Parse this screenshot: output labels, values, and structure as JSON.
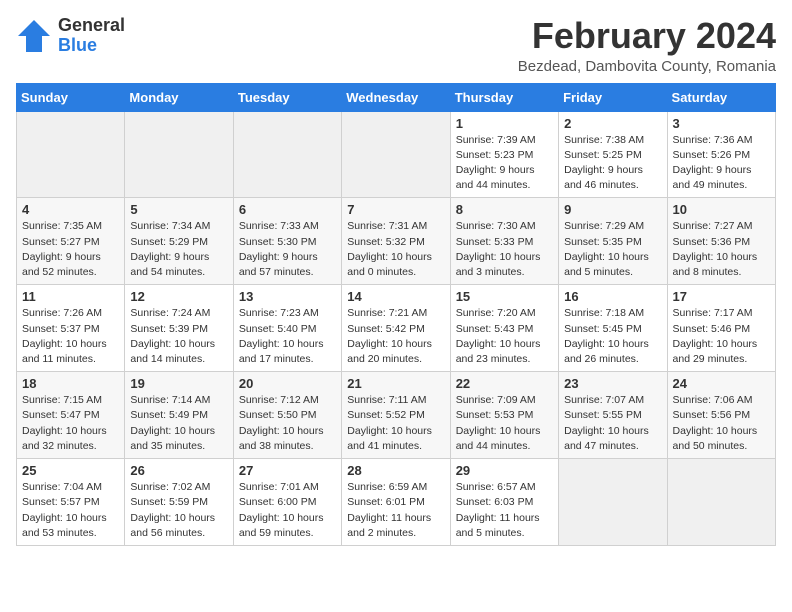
{
  "header": {
    "logo_general": "General",
    "logo_blue": "Blue",
    "month_title": "February 2024",
    "subtitle": "Bezdead, Dambovita County, Romania"
  },
  "weekdays": [
    "Sunday",
    "Monday",
    "Tuesday",
    "Wednesday",
    "Thursday",
    "Friday",
    "Saturday"
  ],
  "weeks": [
    [
      {
        "day": "",
        "sunrise": "",
        "sunset": "",
        "daylight": ""
      },
      {
        "day": "",
        "sunrise": "",
        "sunset": "",
        "daylight": ""
      },
      {
        "day": "",
        "sunrise": "",
        "sunset": "",
        "daylight": ""
      },
      {
        "day": "",
        "sunrise": "",
        "sunset": "",
        "daylight": ""
      },
      {
        "day": "1",
        "sunrise": "Sunrise: 7:39 AM",
        "sunset": "Sunset: 5:23 PM",
        "daylight": "Daylight: 9 hours and 44 minutes."
      },
      {
        "day": "2",
        "sunrise": "Sunrise: 7:38 AM",
        "sunset": "Sunset: 5:25 PM",
        "daylight": "Daylight: 9 hours and 46 minutes."
      },
      {
        "day": "3",
        "sunrise": "Sunrise: 7:36 AM",
        "sunset": "Sunset: 5:26 PM",
        "daylight": "Daylight: 9 hours and 49 minutes."
      }
    ],
    [
      {
        "day": "4",
        "sunrise": "Sunrise: 7:35 AM",
        "sunset": "Sunset: 5:27 PM",
        "daylight": "Daylight: 9 hours and 52 minutes."
      },
      {
        "day": "5",
        "sunrise": "Sunrise: 7:34 AM",
        "sunset": "Sunset: 5:29 PM",
        "daylight": "Daylight: 9 hours and 54 minutes."
      },
      {
        "day": "6",
        "sunrise": "Sunrise: 7:33 AM",
        "sunset": "Sunset: 5:30 PM",
        "daylight": "Daylight: 9 hours and 57 minutes."
      },
      {
        "day": "7",
        "sunrise": "Sunrise: 7:31 AM",
        "sunset": "Sunset: 5:32 PM",
        "daylight": "Daylight: 10 hours and 0 minutes."
      },
      {
        "day": "8",
        "sunrise": "Sunrise: 7:30 AM",
        "sunset": "Sunset: 5:33 PM",
        "daylight": "Daylight: 10 hours and 3 minutes."
      },
      {
        "day": "9",
        "sunrise": "Sunrise: 7:29 AM",
        "sunset": "Sunset: 5:35 PM",
        "daylight": "Daylight: 10 hours and 5 minutes."
      },
      {
        "day": "10",
        "sunrise": "Sunrise: 7:27 AM",
        "sunset": "Sunset: 5:36 PM",
        "daylight": "Daylight: 10 hours and 8 minutes."
      }
    ],
    [
      {
        "day": "11",
        "sunrise": "Sunrise: 7:26 AM",
        "sunset": "Sunset: 5:37 PM",
        "daylight": "Daylight: 10 hours and 11 minutes."
      },
      {
        "day": "12",
        "sunrise": "Sunrise: 7:24 AM",
        "sunset": "Sunset: 5:39 PM",
        "daylight": "Daylight: 10 hours and 14 minutes."
      },
      {
        "day": "13",
        "sunrise": "Sunrise: 7:23 AM",
        "sunset": "Sunset: 5:40 PM",
        "daylight": "Daylight: 10 hours and 17 minutes."
      },
      {
        "day": "14",
        "sunrise": "Sunrise: 7:21 AM",
        "sunset": "Sunset: 5:42 PM",
        "daylight": "Daylight: 10 hours and 20 minutes."
      },
      {
        "day": "15",
        "sunrise": "Sunrise: 7:20 AM",
        "sunset": "Sunset: 5:43 PM",
        "daylight": "Daylight: 10 hours and 23 minutes."
      },
      {
        "day": "16",
        "sunrise": "Sunrise: 7:18 AM",
        "sunset": "Sunset: 5:45 PM",
        "daylight": "Daylight: 10 hours and 26 minutes."
      },
      {
        "day": "17",
        "sunrise": "Sunrise: 7:17 AM",
        "sunset": "Sunset: 5:46 PM",
        "daylight": "Daylight: 10 hours and 29 minutes."
      }
    ],
    [
      {
        "day": "18",
        "sunrise": "Sunrise: 7:15 AM",
        "sunset": "Sunset: 5:47 PM",
        "daylight": "Daylight: 10 hours and 32 minutes."
      },
      {
        "day": "19",
        "sunrise": "Sunrise: 7:14 AM",
        "sunset": "Sunset: 5:49 PM",
        "daylight": "Daylight: 10 hours and 35 minutes."
      },
      {
        "day": "20",
        "sunrise": "Sunrise: 7:12 AM",
        "sunset": "Sunset: 5:50 PM",
        "daylight": "Daylight: 10 hours and 38 minutes."
      },
      {
        "day": "21",
        "sunrise": "Sunrise: 7:11 AM",
        "sunset": "Sunset: 5:52 PM",
        "daylight": "Daylight: 10 hours and 41 minutes."
      },
      {
        "day": "22",
        "sunrise": "Sunrise: 7:09 AM",
        "sunset": "Sunset: 5:53 PM",
        "daylight": "Daylight: 10 hours and 44 minutes."
      },
      {
        "day": "23",
        "sunrise": "Sunrise: 7:07 AM",
        "sunset": "Sunset: 5:55 PM",
        "daylight": "Daylight: 10 hours and 47 minutes."
      },
      {
        "day": "24",
        "sunrise": "Sunrise: 7:06 AM",
        "sunset": "Sunset: 5:56 PM",
        "daylight": "Daylight: 10 hours and 50 minutes."
      }
    ],
    [
      {
        "day": "25",
        "sunrise": "Sunrise: 7:04 AM",
        "sunset": "Sunset: 5:57 PM",
        "daylight": "Daylight: 10 hours and 53 minutes."
      },
      {
        "day": "26",
        "sunrise": "Sunrise: 7:02 AM",
        "sunset": "Sunset: 5:59 PM",
        "daylight": "Daylight: 10 hours and 56 minutes."
      },
      {
        "day": "27",
        "sunrise": "Sunrise: 7:01 AM",
        "sunset": "Sunset: 6:00 PM",
        "daylight": "Daylight: 10 hours and 59 minutes."
      },
      {
        "day": "28",
        "sunrise": "Sunrise: 6:59 AM",
        "sunset": "Sunset: 6:01 PM",
        "daylight": "Daylight: 11 hours and 2 minutes."
      },
      {
        "day": "29",
        "sunrise": "Sunrise: 6:57 AM",
        "sunset": "Sunset: 6:03 PM",
        "daylight": "Daylight: 11 hours and 5 minutes."
      },
      {
        "day": "",
        "sunrise": "",
        "sunset": "",
        "daylight": ""
      },
      {
        "day": "",
        "sunrise": "",
        "sunset": "",
        "daylight": ""
      }
    ]
  ]
}
